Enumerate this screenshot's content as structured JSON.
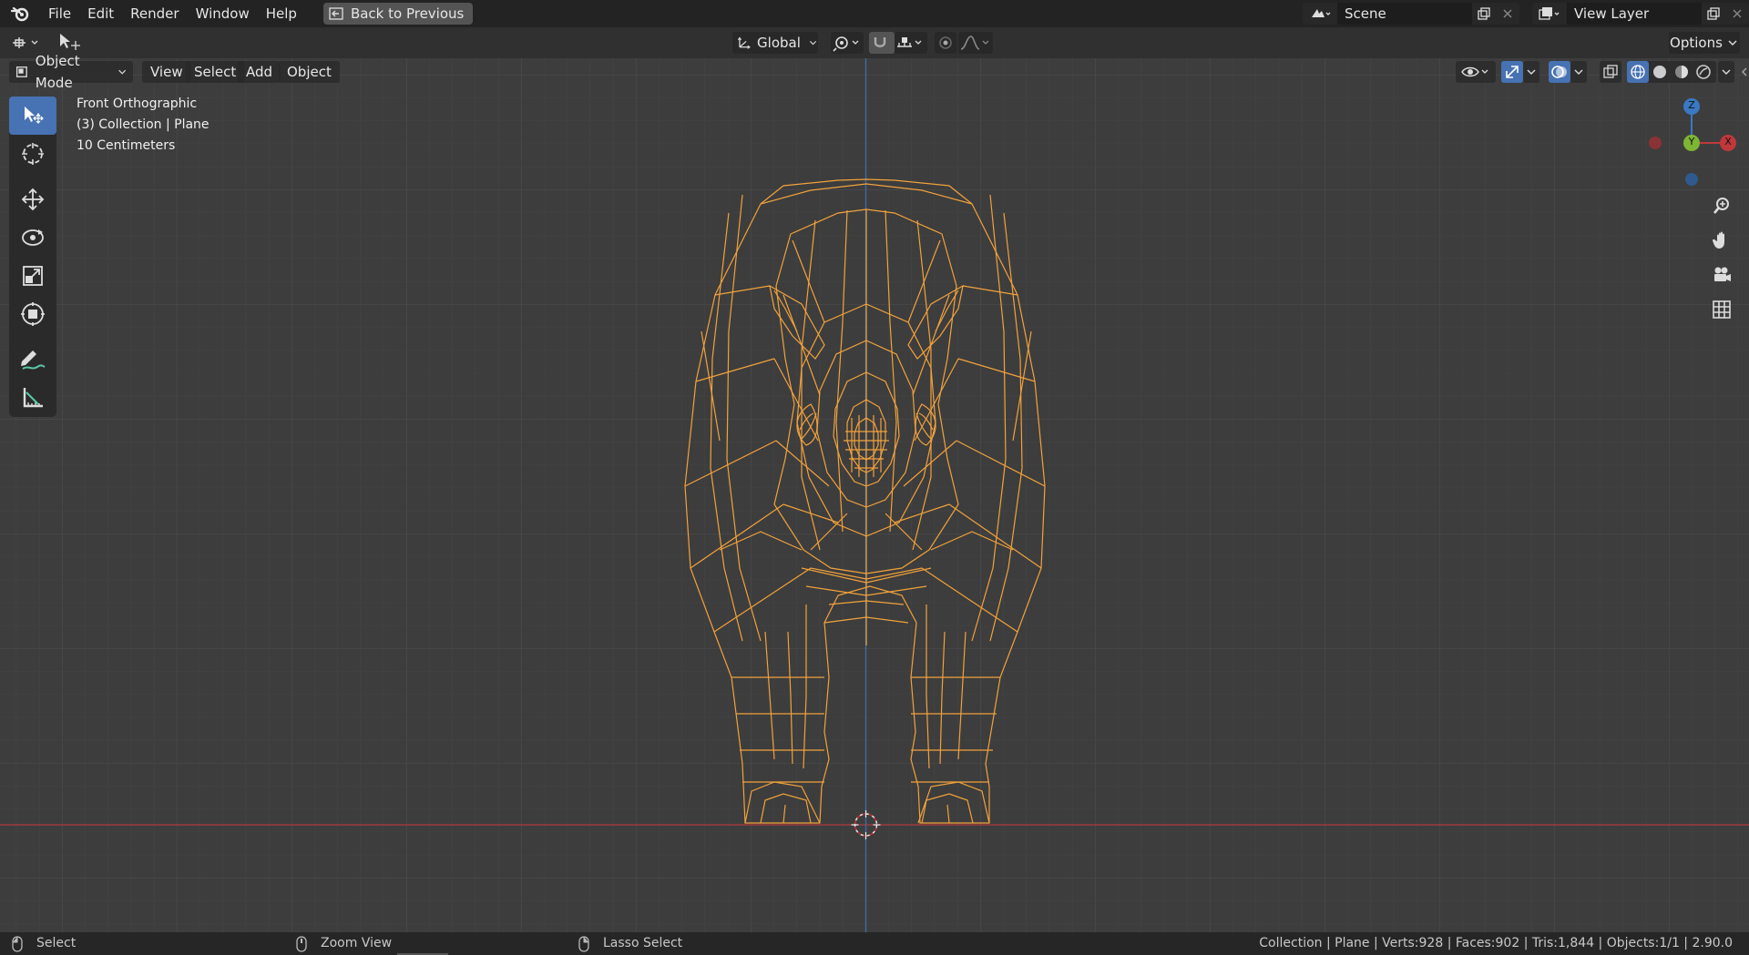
{
  "menu": {
    "file": "File",
    "edit": "Edit",
    "render": "Render",
    "window": "Window",
    "help": "Help"
  },
  "back_button": "Back to Previous",
  "scene": {
    "name": "Scene",
    "view_layer": "View Layer"
  },
  "toolbar": {
    "orientation": "Global",
    "options": "Options"
  },
  "header": {
    "mode": "Object Mode",
    "view": "View",
    "select": "Select",
    "add": "Add",
    "object": "Object"
  },
  "viewport": {
    "view_name": "Front Orthographic",
    "collection": "(3) Collection | Plane",
    "scale": "10 Centimeters"
  },
  "gizmo": {
    "z": "Z",
    "y": "Y",
    "x": "X"
  },
  "status": {
    "select": "Select",
    "zoom": "Zoom View",
    "lasso": "Lasso Select",
    "stats": "Collection | Plane | Verts:928 | Faces:902 | Tris:1,844 | Objects:1/1 | 2.90.0"
  },
  "colors": {
    "accent": "#4772b3",
    "wire": "#f2a23c",
    "x_axis": "#c0383c",
    "z_axis": "#3a78c4",
    "gizmo_y": "#7db534"
  }
}
